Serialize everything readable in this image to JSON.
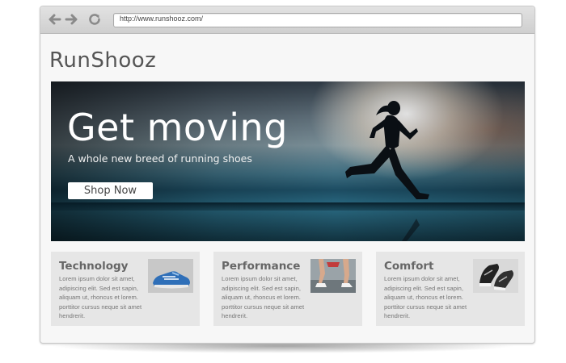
{
  "browser": {
    "back_icon": "back-arrow-icon",
    "forward_icon": "forward-arrow-icon",
    "reload_icon": "reload-icon",
    "url": "http://www.runshooz.com/"
  },
  "site": {
    "logo": "RunShooz"
  },
  "hero": {
    "title": "Get moving",
    "subtitle": "A whole new breed of running shoes",
    "cta_label": "Shop Now"
  },
  "features": [
    {
      "title": "Technology",
      "text": "Lorem ipsum dolor sit amet, adipiscing elit. Sed est sapin, aliquam ut, rhoncus et lorem. porttitor cursus neque sit amet hendrerit.",
      "image_icon": "blue-running-shoe-icon"
    },
    {
      "title": "Performance",
      "text": "Lorem ipsum dolor sit amet, adipiscing elit. Sed est sapin, aliquam ut, rhoncus et lorem. porttitor cursus neque sit amet hendrerit.",
      "image_icon": "runners-legs-icon"
    },
    {
      "title": "Comfort",
      "text": "Lorem ipsum dolor sit amet, adipiscing elit. Sed est sapin, aliquam ut, rhoncus et lorem. porttitor cursus neque sit amet hendrerit.",
      "image_icon": "black-white-shoes-icon"
    }
  ],
  "colors": {
    "chrome": "#d6d6d6",
    "page_bg": "#f7f7f7",
    "card_bg": "#e6e6e6",
    "hero_sky": "#5d6d78",
    "hero_water": "#1c4c62"
  }
}
